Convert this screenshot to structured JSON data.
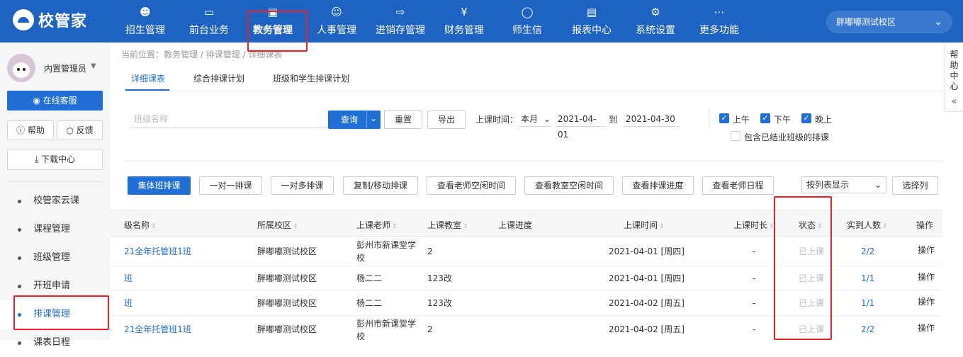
{
  "brand": {
    "name": "校管家"
  },
  "nav": [
    {
      "label": "招生管理",
      "icon": "user-plus-icon"
    },
    {
      "label": "前台业务",
      "icon": "monitor-icon"
    },
    {
      "label": "教务管理",
      "icon": "bookmark-icon"
    },
    {
      "label": "人事管理",
      "icon": "person-icon"
    },
    {
      "label": "进销存管理",
      "icon": "inventory-icon"
    },
    {
      "label": "财务管理",
      "icon": "yen-shield-icon"
    },
    {
      "label": "师生信",
      "icon": "chat-icon"
    },
    {
      "label": "报表中心",
      "icon": "report-icon"
    },
    {
      "label": "系统设置",
      "icon": "gear-icon"
    },
    {
      "label": "更多功能",
      "icon": "more-icon"
    }
  ],
  "campus": {
    "name": "胖嘟嘟测试校区"
  },
  "user": {
    "name": "内置管理员"
  },
  "sidebar": {
    "service": "在线客服",
    "help": "帮助",
    "feedback": "反馈",
    "download": "下载中心",
    "menu": [
      "校管家云课",
      "课程管理",
      "班级管理",
      "开班申请",
      "排课管理",
      "课表日程"
    ]
  },
  "breadcrumb": "当前位置：教务管理 / 排课管理 / 详细课表",
  "tabs": [
    "详细课表",
    "综合排课计划",
    "班级和学生排课计划"
  ],
  "filters": {
    "class_placeholder": "班级名称",
    "query": "查询",
    "reset": "重置",
    "export": "导出",
    "time_label": "上课时间：",
    "period": "本月",
    "start_date": "2021-04-01",
    "to": "到",
    "end_date": "2021-04-30",
    "morning": "上午",
    "afternoon": "下午",
    "evening": "晚上",
    "include_finished": "包含已结业班级的排课"
  },
  "actions": [
    "集体班排课",
    "一对一排课",
    "一对多排课",
    "复制/移动排课",
    "查看老师空闲时间",
    "查看教室空闲时间",
    "查看排课进度",
    "查看老师日程"
  ],
  "view_select": "按列表显示",
  "choose_columns": "选择列",
  "table": {
    "headers": [
      "级名称",
      "所属校区",
      "上课老师",
      "上课教室",
      "上课进度",
      "上课时间",
      "上课时长",
      "状态",
      "实到人数",
      "操作"
    ],
    "rows": [
      {
        "name": "21全年托管班1班",
        "campus": "胖嘟嘟测试校区",
        "teacher": "彭州市新课堂学",
        "teacher2": "校",
        "room": "2",
        "progress": "",
        "time": "2021-04-01 [周四]",
        "duration": "-",
        "status": "已上课",
        "count": "2/2",
        "op": "操作"
      },
      {
        "name": "班",
        "campus": "胖嘟嘟测试校区",
        "teacher": "杨二二",
        "teacher2": "",
        "room": "123改",
        "progress": "",
        "time": "2021-04-01 [周四]",
        "duration": "-",
        "status": "已上课",
        "count": "1/1",
        "op": "操作"
      },
      {
        "name": "班",
        "campus": "胖嘟嘟测试校区",
        "teacher": "杨二二",
        "teacher2": "",
        "room": "123改",
        "progress": "",
        "time": "2021-04-02 [周五]",
        "duration": "-",
        "status": "已上课",
        "count": "1/1",
        "op": "操作"
      },
      {
        "name": "21全年托管班1班",
        "campus": "胖嘟嘟测试校区",
        "teacher": "彭州市新课堂学",
        "teacher2": "校",
        "room": "2",
        "progress": "",
        "time": "2021-04-02 [周五]",
        "duration": "-",
        "status": "已上课",
        "count": "2/2",
        "op": "操作"
      }
    ]
  },
  "help_center": "帮助中心",
  "colors": {
    "brand": "#1f63c2",
    "accent": "#1f6fd6",
    "highlight": "#e8212a"
  }
}
